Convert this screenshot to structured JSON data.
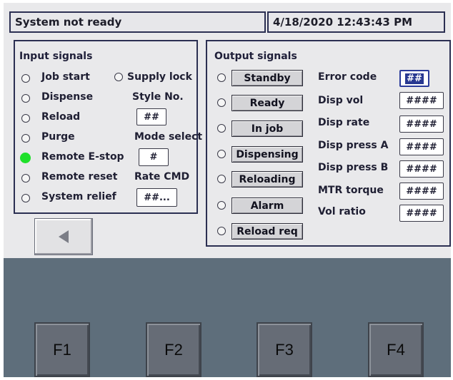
{
  "header": {
    "status": "System not ready",
    "datetime": "4/18/2020 12:43:43 PM"
  },
  "input_panel": {
    "title": "Input signals",
    "signals": [
      {
        "label": "Job start",
        "active": false
      },
      {
        "label": "Dispense",
        "active": false
      },
      {
        "label": "Reload",
        "active": false
      },
      {
        "label": "Purge",
        "active": false
      },
      {
        "label": "Remote E-stop",
        "active": true
      },
      {
        "label": "Remote reset",
        "active": false
      },
      {
        "label": "System relief",
        "active": false
      }
    ],
    "supply_lock": "Supply lock",
    "style_no": {
      "label": "Style No.",
      "value": "##"
    },
    "mode_select": {
      "label": "Mode select",
      "value": "#"
    },
    "rate_cmd": {
      "label": "Rate CMD",
      "value": "##..."
    }
  },
  "output_panel": {
    "title": "Output signals",
    "buttons": [
      "Standby",
      "Ready",
      "In job",
      "Dispensing",
      "Reloading",
      "Alarm",
      "Reload req"
    ],
    "readouts": [
      {
        "label": "Error code",
        "value": "##"
      },
      {
        "label": "Disp vol",
        "value": "####"
      },
      {
        "label": "Disp rate",
        "value": "####"
      },
      {
        "label": "Disp press A",
        "value": "####"
      },
      {
        "label": "Disp press B",
        "value": "####"
      },
      {
        "label": "MTR torque",
        "value": "####"
      },
      {
        "label": "Vol ratio",
        "value": "####"
      }
    ]
  },
  "nav": {
    "back_icon": "triangle-left-icon"
  },
  "function_keys": [
    "F1",
    "F2",
    "F3",
    "F4"
  ],
  "colors": {
    "active_indicator": "#1fe02a",
    "panel_border": "#2b2f52",
    "bezel": "#5e6e7b"
  }
}
